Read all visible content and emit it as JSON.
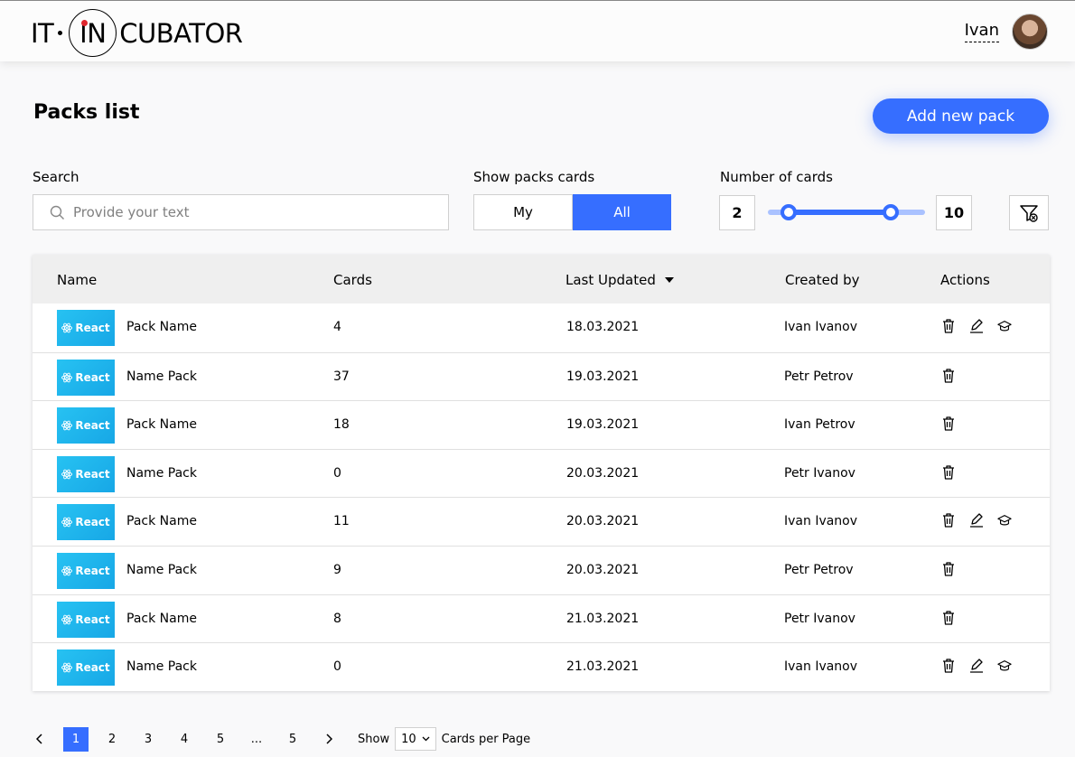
{
  "header": {
    "logo": {
      "left": "IT",
      "middle": "IN",
      "right": "CUBATOR"
    },
    "user_name": "Ivan"
  },
  "page": {
    "title": "Packs list",
    "add_button": "Add new pack"
  },
  "filters": {
    "search_label": "Search",
    "search_placeholder": "Provide your text",
    "show_label": "Show packs cards",
    "show_options": [
      "My",
      "All"
    ],
    "show_selected": "All",
    "number_label": "Number of cards",
    "min_value": "2",
    "max_value": "10",
    "slider_range_fraction": [
      0.13,
      0.78
    ]
  },
  "table": {
    "headers": {
      "name": "Name",
      "cards": "Cards",
      "updated": "Last Updated",
      "created": "Created by",
      "actions": "Actions"
    },
    "thumb_label": "React",
    "rows": [
      {
        "name": "Pack Name",
        "cards": "4",
        "updated": "18.03.2021",
        "created": "Ivan Ivanov",
        "actions": [
          "delete",
          "edit",
          "learn"
        ]
      },
      {
        "name": "Name Pack",
        "cards": "37",
        "updated": "19.03.2021",
        "created": "Petr Petrov",
        "actions": [
          "delete"
        ]
      },
      {
        "name": "Pack Name",
        "cards": "18",
        "updated": "19.03.2021",
        "created": "Ivan Petrov",
        "actions": [
          "delete"
        ]
      },
      {
        "name": "Name Pack",
        "cards": "0",
        "updated": "20.03.2021",
        "created": "Petr Ivanov",
        "actions": [
          "delete"
        ]
      },
      {
        "name": "Pack Name",
        "cards": "11",
        "updated": "20.03.2021",
        "created": "Ivan Ivanov",
        "actions": [
          "delete",
          "edit",
          "learn"
        ]
      },
      {
        "name": "Name Pack",
        "cards": "9",
        "updated": "20.03.2021",
        "created": "Petr Petrov",
        "actions": [
          "delete"
        ]
      },
      {
        "name": "Pack Name",
        "cards": "8",
        "updated": "21.03.2021",
        "created": "Petr Ivanov",
        "actions": [
          "delete"
        ]
      },
      {
        "name": "Name Pack",
        "cards": "0",
        "updated": "21.03.2021",
        "created": "Ivan Ivanov",
        "actions": [
          "delete",
          "edit",
          "learn"
        ]
      }
    ]
  },
  "pagination": {
    "pages": [
      "1",
      "2",
      "3",
      "4",
      "5",
      "...",
      "5"
    ],
    "active": "1",
    "show_label": "Show",
    "per_page": "10",
    "per_page_suffix": "Cards per Page"
  },
  "colors": {
    "accent": "#366eff",
    "react": "#27c2f2",
    "logo_dot": "#e0262e"
  }
}
